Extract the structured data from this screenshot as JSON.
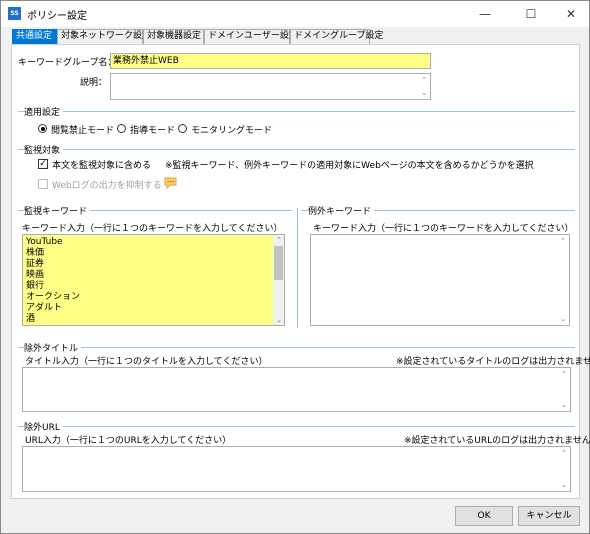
{
  "window": {
    "title": "ポリシー設定",
    "icon_text": "SS"
  },
  "tabs": [
    {
      "label": "共通設定"
    },
    {
      "label": "対象ネットワーク設定"
    },
    {
      "label": "対象機器設定"
    },
    {
      "label": "ドメインユーザー設定"
    },
    {
      "label": "ドメイングループ設定"
    }
  ],
  "keyword_group": {
    "name_label": "キーワードグループ名：",
    "name_value": "業務外禁止WEB",
    "desc_label": "説明："
  },
  "apply": {
    "title": "適用設定",
    "options": [
      {
        "label": "閲覧禁止モード",
        "selected": true
      },
      {
        "label": "指導モード",
        "selected": false
      },
      {
        "label": "モニタリングモード",
        "selected": false
      }
    ]
  },
  "monitor": {
    "title": "監視対象",
    "include_body_label": "本文を監視対象に含める",
    "include_body_checked": true,
    "note": "※監視キーワード、例外キーワードの適用対象にWebページの本文を含めるかどうかを選択",
    "suppress_log_label": "Webログの出力を抑制する",
    "suppress_log_checked": false
  },
  "monitor_keywords": {
    "title": "監視キーワード",
    "input_label": "キーワード入力（一行に１つのキーワードを入力してください）",
    "items": [
      "YouTube",
      "株価",
      "証券",
      "映画",
      "銀行",
      "オークション",
      "アダルト",
      "酒"
    ]
  },
  "exception_keywords": {
    "title": "例外キーワード",
    "input_label": "キーワード入力（一行に１つのキーワードを入力してください）"
  },
  "exclude_title": {
    "title": "除外タイトル",
    "input_label": "タイトル入力（一行に１つのタイトルを入力してください）",
    "note": "※設定されているタイトルのログは出力されません"
  },
  "exclude_url": {
    "title": "除外URL",
    "input_label": "URL入力（一行に１つのURLを入力してください）",
    "note": "※設定されているURLのログは出力されません"
  },
  "buttons": {
    "ok": "OK",
    "cancel": "キャンセル"
  },
  "icons": {
    "minimize": "minimize-icon",
    "maximize": "maximize-icon",
    "close": "close-icon",
    "scroll_up": "scroll-up-icon",
    "scroll_down": "scroll-down-icon",
    "comment": "comment-icon"
  },
  "colors": {
    "accent": "#0078d7",
    "highlight": "#ffff88",
    "section_line": "#9ec1e8"
  }
}
